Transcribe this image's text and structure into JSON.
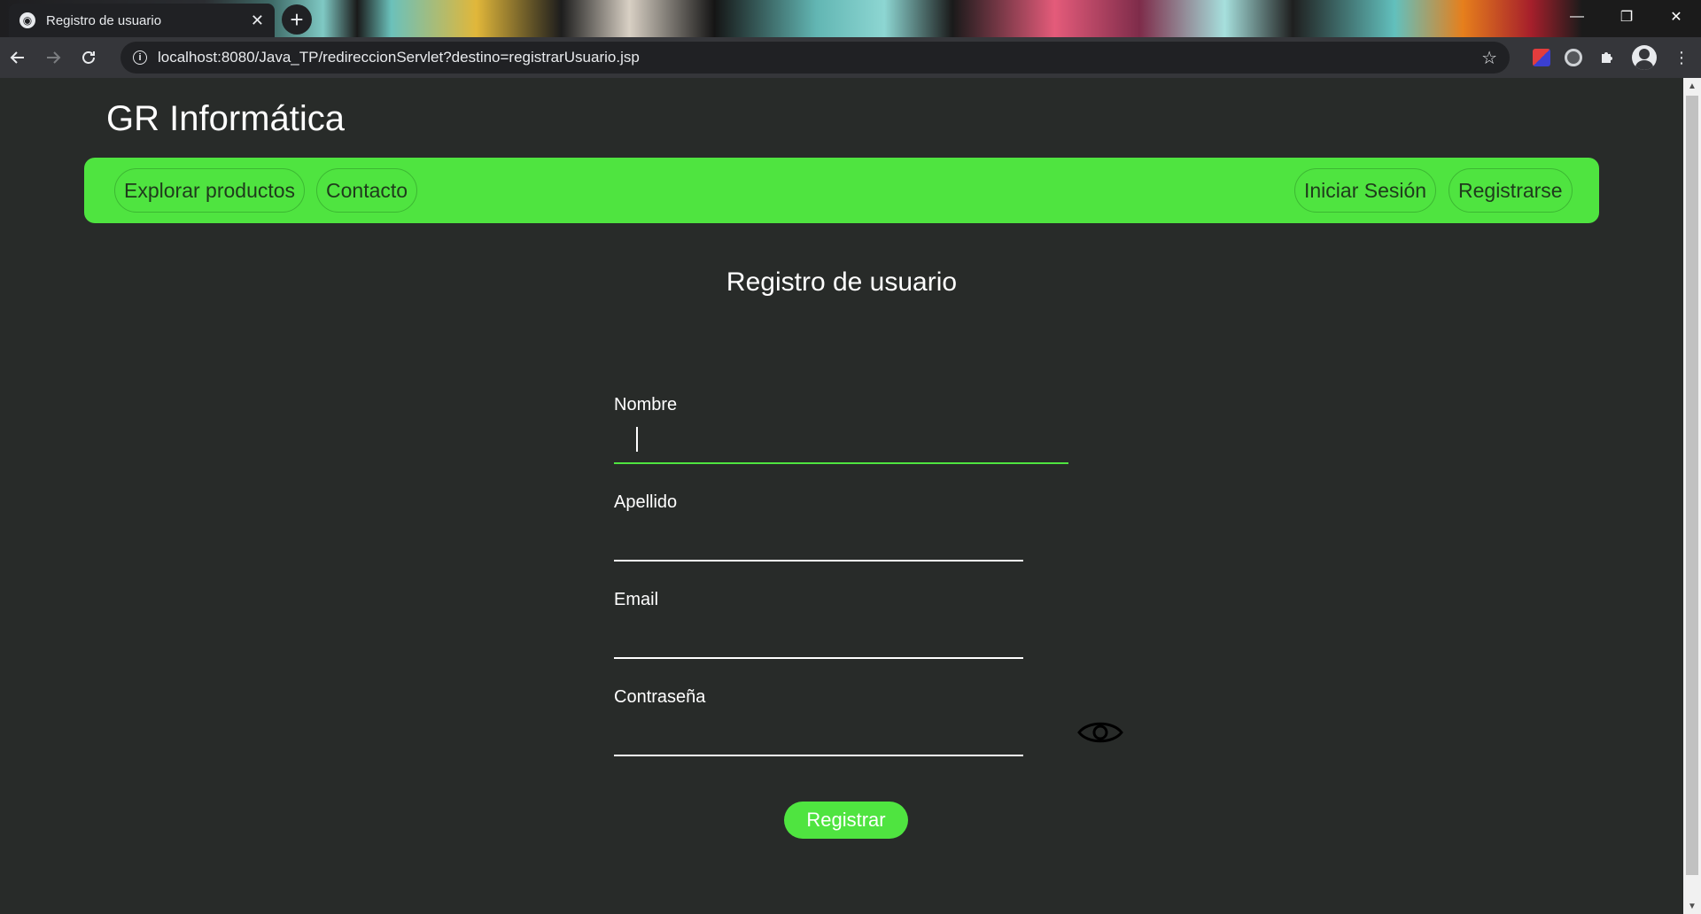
{
  "browser": {
    "tab_title": "Registro de usuario",
    "tab_close": "✕",
    "new_tab": "+",
    "url": "localhost:8080/Java_TP/redireccionServlet?destino=registrarUsuario.jsp",
    "window_controls": {
      "minimize": "—",
      "restore": "❐",
      "close": "✕"
    }
  },
  "site": {
    "brand": "GR Informática",
    "nav_left": [
      "Explorar productos",
      "Contacto"
    ],
    "nav_right": [
      "Iniciar Sesión",
      "Registrarse"
    ]
  },
  "form": {
    "title": "Registro de usuario",
    "fields": [
      {
        "label": "Nombre",
        "value": ""
      },
      {
        "label": "Apellido",
        "value": ""
      },
      {
        "label": "Email",
        "value": ""
      },
      {
        "label": "Contraseña",
        "value": ""
      }
    ],
    "submit_label": "Registrar"
  },
  "colors": {
    "accent": "#4fe440",
    "page_background": "#282b29",
    "text": "#ffffff"
  }
}
